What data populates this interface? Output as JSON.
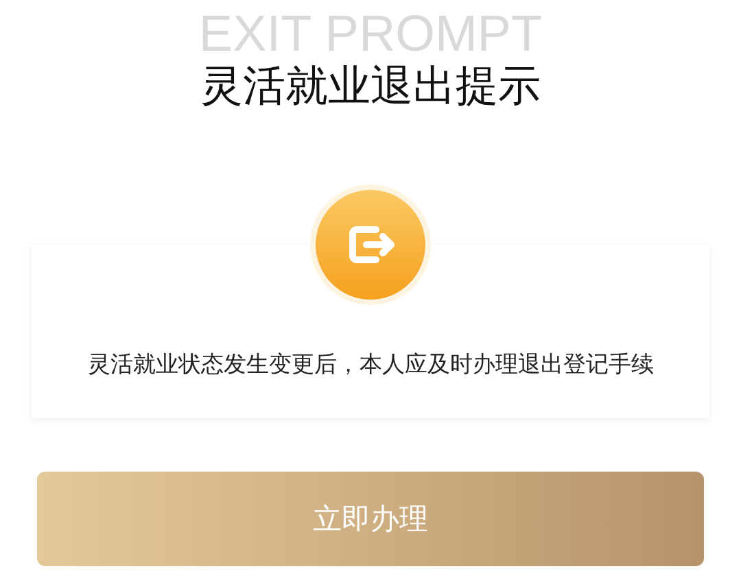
{
  "header": {
    "background_text": "EXIT PROMPT",
    "title": "灵活就业退出提示"
  },
  "card": {
    "message": "灵活就业状态发生变更后，本人应及时办理退出登记手续"
  },
  "buttons": [
    "立即办理"
  ]
}
